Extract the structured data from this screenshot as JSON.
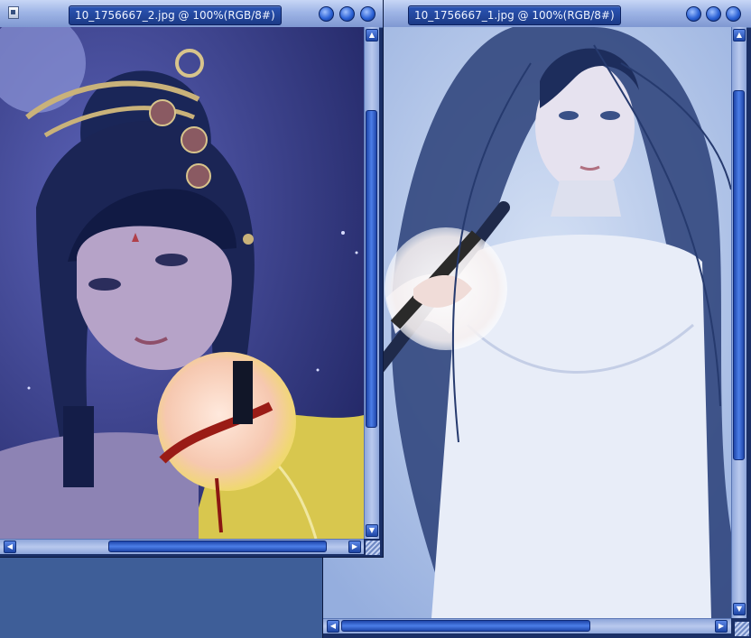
{
  "windows": [
    {
      "title": "10_1756667_2.jpg @ 100%(RGB/8#)",
      "icon": "document-icon",
      "buttons": [
        "minimize",
        "maximize",
        "close"
      ],
      "content": "illustration of a dark-haired woman in blue tones with ornate hair pins, a circular brush-preview overlay on her hand"
    },
    {
      "title": "10_1756667_1.jpg @ 100%(RGB/8#)",
      "buttons": [
        "minimize",
        "maximize",
        "close"
      ],
      "content": "illustration of a long-haired woman in a white dress in pale blue tones, a circular brush-preview overlay on her hand"
    }
  ],
  "colors": {
    "workspace": "#3e5e98",
    "titlebar": "#9fb5e6",
    "title_tab": "#1c3a86",
    "scroll_thumb": "#2f5fd0"
  },
  "icons": {
    "arrow_up": "▲",
    "arrow_down": "▼",
    "arrow_left": "◀",
    "arrow_right": "▶"
  }
}
